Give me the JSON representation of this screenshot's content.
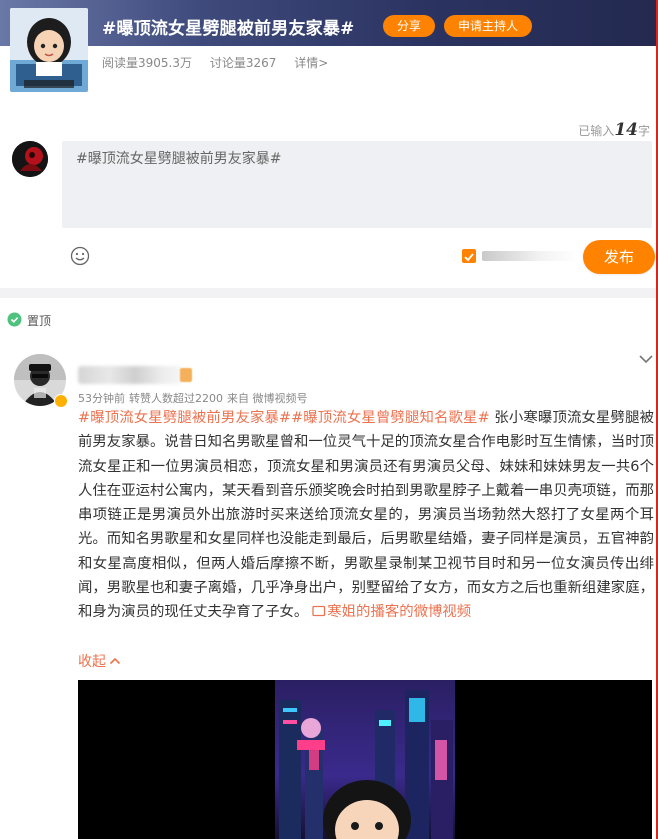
{
  "topic": {
    "title": "#曝顶流女星劈腿被前男友家暴#",
    "share_label": "分享",
    "host_label": "申请主持人",
    "read_count": "阅读量3905.3万",
    "discuss_count": "讨论量3267",
    "details_link": "详情>"
  },
  "compose": {
    "char_count_prefix": "已输入",
    "char_count_value": "14",
    "char_count_suffix": "字",
    "text": "#曝顶流女星劈腿被前男友家暴#",
    "publish_label": "发布"
  },
  "pinned": {
    "label": "置顶"
  },
  "post": {
    "meta": {
      "time": "53分钟前",
      "repost_hint": "转赞人数超过2200",
      "source": "来自 微博视频号"
    },
    "tags": [
      "#曝顶流女星劈腿被前男友家暴#",
      "#曝顶流女星曾劈腿知名歌星#"
    ],
    "body_text": " 张小寒曝顶流女星劈腿被前男友家暴。说昔日知名男歌星曾和一位灵气十足的顶流女星合作电影时互生情愫，当时顶流女星正和一位男演员相恋，顶流女星和男演员还有男演员父母、妹妹和妹妹男友一共6个人住在亚运村公寓内，某天看到音乐颁奖晚会时拍到男歌星脖子上戴着一串贝壳项链，而那串项链正是男演员外出旅游时买来送给顶流女星的，男演员当场勃然大怒打了女星两个耳光。而知名男歌星和女星同样也没能走到最后，后男歌星结婚，妻子同样是演员，五官神韵和女星高度相似，但两人婚后摩擦不断，男歌星录制某卫视节目时和另一位女演员传出绯闻，男歌星也和妻子离婚，几乎净身出户，别墅留给了女方，而女方之后也重新组建家庭，和身为演员的现任丈夫孕育了子女。",
    "video_link": "寒姐的播客的微博视频",
    "collapse_label": "收起"
  },
  "colors": {
    "accent": "#ff8200",
    "link": "#eb7350",
    "banner": "#2b3361"
  },
  "icons": {
    "emoji": "smiley-icon",
    "pin": "pin-icon",
    "chevron": "chevron-down-icon",
    "video_link": "video-icon"
  }
}
